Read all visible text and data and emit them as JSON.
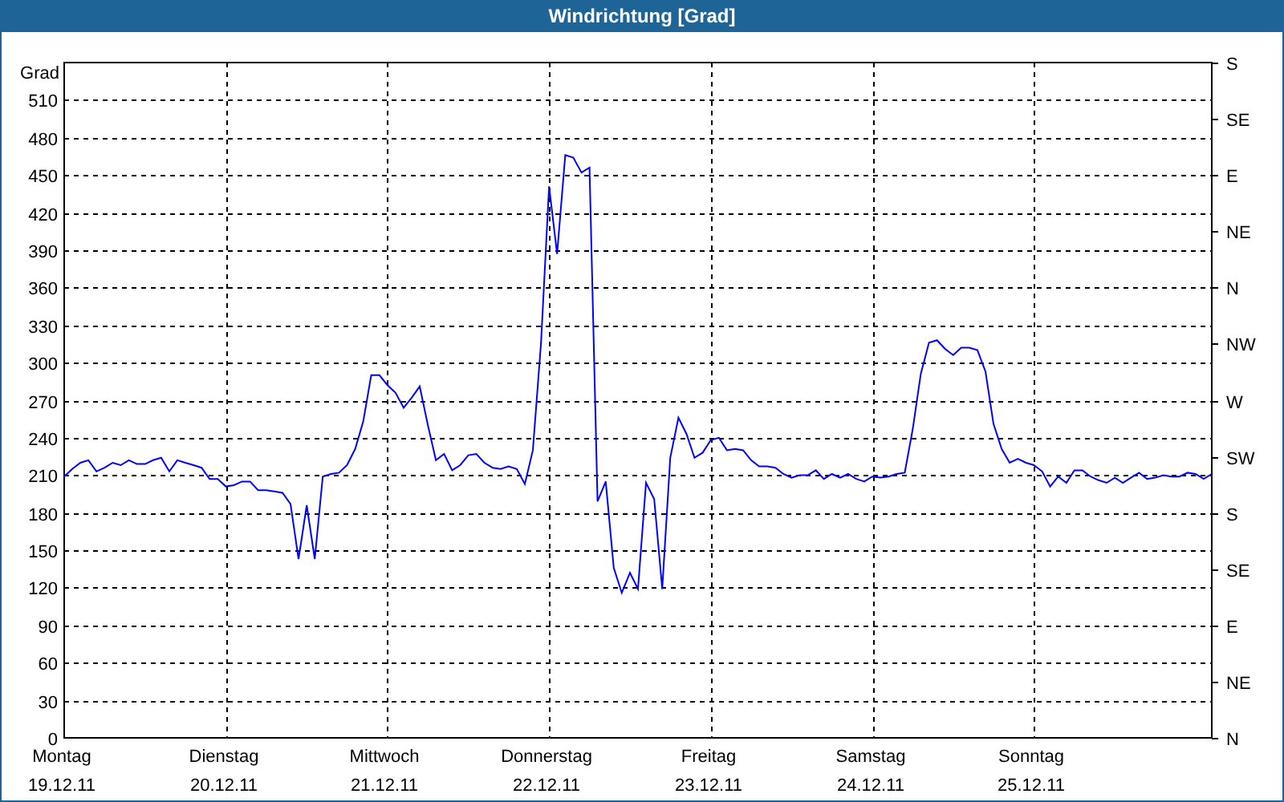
{
  "window": {
    "title": "Windrichtung [Grad]"
  },
  "chart": {
    "dates": [
      "19.12.11",
      "20.12.11",
      "21.12.11",
      "22.12.11",
      "23.12.11",
      "24.12.11",
      "25.12.11"
    ],
    "direction_labels": [
      "S",
      "SE",
      "E",
      "NE",
      "N",
      "NW",
      "W",
      "SW",
      "S",
      "SE",
      "E",
      "NE",
      "N"
    ],
    "chart_data": {
      "type": "line",
      "ylabel": "Grad",
      "grid": true,
      "ylim": [
        0,
        540
      ],
      "yticks": [
        0,
        30,
        60,
        90,
        120,
        150,
        180,
        210,
        240,
        270,
        300,
        330,
        360,
        390,
        420,
        450,
        480,
        510
      ],
      "categories": [
        "Montag",
        null,
        null,
        null,
        null,
        null,
        null,
        null,
        null,
        null,
        null,
        null,
        null,
        null,
        null,
        null,
        null,
        null,
        null,
        null,
        "Dienstag",
        null,
        null,
        null,
        null,
        null,
        null,
        null,
        null,
        null,
        null,
        null,
        null,
        null,
        null,
        null,
        null,
        null,
        null,
        null,
        "Mittwoch",
        null,
        null,
        null,
        null,
        null,
        null,
        null,
        null,
        null,
        null,
        null,
        null,
        null,
        null,
        null,
        null,
        null,
        null,
        null,
        "Donnerstag",
        null,
        null,
        null,
        null,
        null,
        null,
        null,
        null,
        null,
        null,
        null,
        null,
        null,
        null,
        null,
        null,
        null,
        null,
        null,
        "Freitag",
        null,
        null,
        null,
        null,
        null,
        null,
        null,
        null,
        null,
        null,
        null,
        null,
        null,
        null,
        null,
        null,
        null,
        null,
        null,
        "Samstag",
        null,
        null,
        null,
        null,
        null,
        null,
        null,
        null,
        null,
        null,
        null,
        null,
        null,
        null,
        null,
        null,
        null,
        null,
        null,
        "Sonntag",
        null,
        null,
        null,
        null,
        null,
        null,
        null,
        null,
        null,
        null,
        null,
        null,
        null,
        null,
        null,
        null,
        null,
        null,
        null,
        null,
        null,
        null
      ],
      "series": [
        {
          "color": "#0000ff",
          "values": [
            209,
            215,
            220,
            222,
            213,
            216,
            220,
            218,
            222,
            219,
            219,
            222,
            224,
            213,
            222,
            220,
            218,
            216,
            207,
            207,
            201,
            202,
            205,
            205,
            198,
            198,
            197,
            196,
            187,
            143,
            186,
            143,
            209,
            211,
            212,
            218,
            231,
            253,
            290,
            290,
            282,
            276,
            264,
            272,
            281,
            250,
            222,
            227,
            214,
            218,
            226,
            227,
            220,
            216,
            215,
            217,
            215,
            203,
            230,
            316,
            441,
            387,
            466,
            464,
            452,
            456,
            189,
            205,
            136,
            116,
            132,
            119,
            204,
            191,
            119,
            224,
            256,
            243,
            224,
            228,
            238,
            240,
            230,
            231,
            230,
            222,
            217,
            217,
            216,
            211,
            208,
            210,
            210,
            214,
            207,
            211,
            208,
            211,
            207,
            205,
            209,
            208,
            209,
            211,
            212,
            247,
            291,
            316,
            318,
            311,
            306,
            312,
            312,
            310,
            293,
            251,
            231,
            220,
            223,
            220,
            218,
            213,
            201,
            209,
            204,
            214,
            214,
            209,
            206,
            204,
            208,
            204,
            208,
            212,
            207,
            208,
            210,
            209,
            209,
            212,
            211,
            207,
            211
          ]
        }
      ]
    }
  }
}
